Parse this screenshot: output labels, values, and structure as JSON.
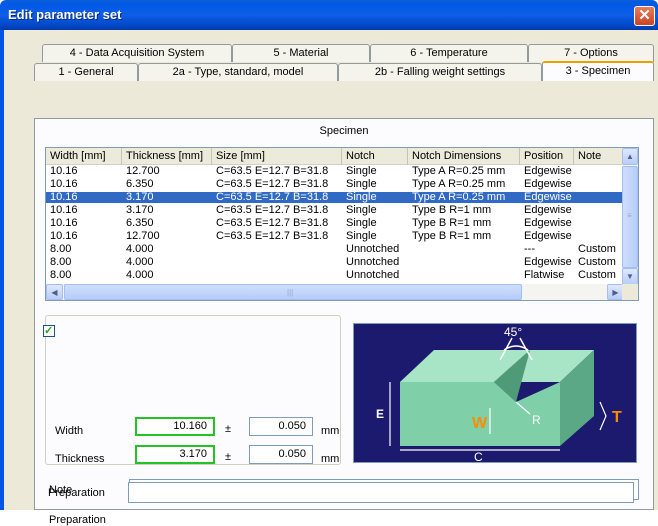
{
  "window": {
    "title": "Edit parameter set",
    "close_glyph": "✕"
  },
  "tabs": {
    "row_back": [
      {
        "label": "4 - Data Acquisition System"
      },
      {
        "label": "5 - Material"
      },
      {
        "label": "6 - Temperature"
      },
      {
        "label": "7 - Options"
      }
    ],
    "row_front": [
      {
        "label": "1 - General"
      },
      {
        "label": "2a - Type, standard, model"
      },
      {
        "label": "2b - Falling weight settings"
      },
      {
        "label": "3 - Specimen",
        "active": true
      }
    ]
  },
  "specimen": {
    "section_label": "Specimen",
    "columns": [
      "Width [mm]",
      "Thickness [mm]",
      "Size [mm]",
      "Notch",
      "Notch Dimensions",
      "Position",
      "Note"
    ],
    "rows": [
      [
        "10.16",
        "12.700",
        "C=63.5 E=12.7 B=31.8",
        "Single",
        "Type A R=0.25 mm",
        "Edgewise",
        ""
      ],
      [
        "10.16",
        "6.350",
        "C=63.5 E=12.7 B=31.8",
        "Single",
        "Type A R=0.25 mm",
        "Edgewise",
        ""
      ],
      [
        "10.16",
        "3.170",
        "C=63.5 E=12.7 B=31.8",
        "Single",
        "Type A R=0.25 mm",
        "Edgewise",
        ""
      ],
      [
        "10.16",
        "3.170",
        "C=63.5 E=12.7 B=31.8",
        "Single",
        "Type B R=1 mm",
        "Edgewise",
        ""
      ],
      [
        "10.16",
        "6.350",
        "C=63.5 E=12.7 B=31.8",
        "Single",
        "Type B R=1 mm",
        "Edgewise",
        ""
      ],
      [
        "10.16",
        "12.700",
        "C=63.5 E=12.7 B=31.8",
        "Single",
        "Type B R=1 mm",
        "Edgewise",
        ""
      ],
      [
        "8.00",
        "4.000",
        "",
        "Unnotched",
        "",
        "---",
        "Custom"
      ],
      [
        "8.00",
        "4.000",
        "",
        "Unnotched",
        "",
        "Edgewise",
        "Custom"
      ],
      [
        "8.00",
        "4.000",
        "",
        "Unnotched",
        "",
        "Flatwise",
        "Custom"
      ]
    ],
    "selected_row": 2,
    "scroll_up_glyph": "▲",
    "scroll_down_glyph": "▼",
    "scroll_left_glyph": "◀",
    "scroll_right_glyph": "▶",
    "scroll_grip_glyph": "≡",
    "scroll_hgrip_glyph": "|||"
  },
  "dimensions": {
    "checkbox_checked": true,
    "checkbox_glyph": "✓",
    "width_label": "Width",
    "width_value": "10.160",
    "width_tolerance": "0.050",
    "thickness_label": "Thickness",
    "thickness_value": "3.170",
    "thickness_tolerance": "0.050",
    "plus_minus": "±",
    "unit": "mm"
  },
  "diagram": {
    "angle_label": "45°",
    "e_label": "E",
    "w_label": "W",
    "r_label": "R",
    "t_label": "T",
    "c_label": "C",
    "background": "#1c1a6e",
    "specimen_color": "#7fcfa8",
    "accent_color": "#ff8c00"
  },
  "note": {
    "label": "Note",
    "value": ""
  },
  "preparation": {
    "label": "Preparation",
    "value": ""
  }
}
